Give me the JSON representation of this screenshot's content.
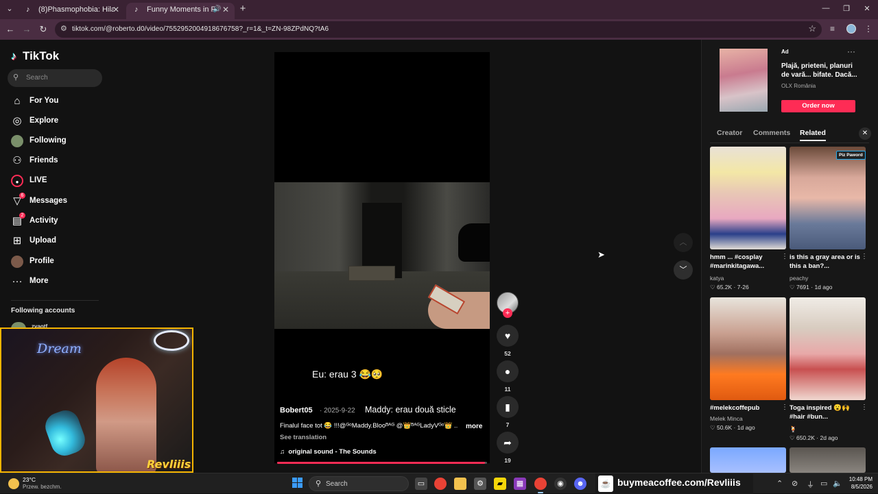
{
  "browser": {
    "tabs": [
      {
        "title": "(8)Phasmophobia: Hilarious Gh",
        "icon": "tiktok-icon"
      },
      {
        "title": "Funny Moments in Phasmo",
        "icon": "tiktok-icon"
      }
    ],
    "url": "tiktok.com/@roberto.d0/video/7552952004918676758?_r=1&_t=ZN-98ZPdNQ?tA6"
  },
  "tiktok": {
    "logo": "TikTok",
    "search_placeholder": "Search",
    "nav": [
      {
        "label": "For You",
        "icon": "home-icon"
      },
      {
        "label": "Explore",
        "icon": "compass-icon"
      },
      {
        "label": "Following",
        "icon": "avatar-icon"
      },
      {
        "label": "Friends",
        "icon": "friends-icon"
      },
      {
        "label": "LIVE",
        "icon": "live-icon"
      },
      {
        "label": "Messages",
        "icon": "messages-icon",
        "badge": "6"
      },
      {
        "label": "Activity",
        "icon": "activity-icon",
        "badge": "2"
      },
      {
        "label": "Upload",
        "icon": "upload-icon"
      },
      {
        "label": "Profile",
        "icon": "profile-icon"
      },
      {
        "label": "More",
        "icon": "more-icon"
      }
    ],
    "following_accounts_title": "Following accounts",
    "following_peek": "zvaotf"
  },
  "video": {
    "caption_big": "Eu: erau 3 😂🥺",
    "author": "Bobert05",
    "date": "· 2025-9-22",
    "overlay_text": "Maddy: erau două sticle",
    "description": "Finalul face tot 😂 !!!@ᴳᵒMaddy.Blooᴮᴬᴳ @👑ᴮᴬᴳLadyVᴳᵒ👑 ...",
    "more": "more",
    "translate": "See translation",
    "sound": "original sound - The Sounds",
    "progress": 0.99,
    "actions": {
      "likes": "52",
      "comments": "11",
      "saves": "7",
      "shares": "19"
    }
  },
  "ad": {
    "label": "Ad",
    "text": "Plajă, prieteni, planuri de vară... bifate. Dacă...",
    "brand": "OLX România",
    "cta": "Order now"
  },
  "panel_tabs": [
    "Creator",
    "Comments",
    "Related"
  ],
  "related": [
    {
      "title": "hmm ... #cosplay #marinkitagawa...",
      "author": "katya",
      "stats": "♡ 65.2K · 7-26"
    },
    {
      "title": "is this a gray area or is this a ban?...",
      "author": "peachy",
      "stats": "♡ 7691 · 1d ago",
      "pill": "Piz Paword"
    },
    {
      "title": "#melekcoffepub",
      "author": "Melek Minca",
      "stats": "♡ 50.6K · 1d ago"
    },
    {
      "title": "Toga inspired 😮🙌 #hair #bun...",
      "author": "🍹",
      "stats": "♡ 650.2K · 2d ago"
    }
  ],
  "webcam": {
    "neon": "Dream",
    "brand": "Revliiis"
  },
  "taskbar": {
    "temp": "23°C",
    "weather": "Przew. bezchm.",
    "search": "Search",
    "bmc": "buymeacoffee.com/Revliiis",
    "time": "10:48 PM",
    "date": "8/5/2026"
  }
}
